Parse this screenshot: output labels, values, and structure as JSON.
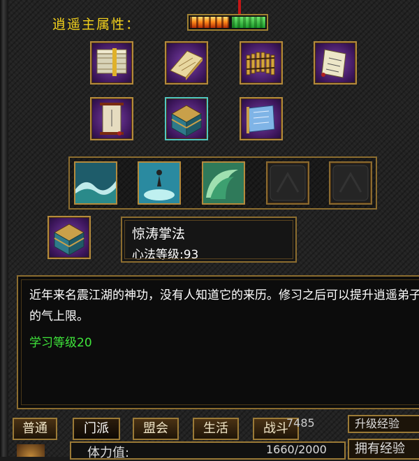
{
  "header": {
    "attr_label": "逍遥主属性：",
    "attr_icons": [
      "fire-element-icon",
      "wood-element-icon"
    ],
    "attr_colors": {
      "fire": "#ff8a1a",
      "wood": "#3fd84a"
    }
  },
  "books": [
    {
      "name": "book-bundle-icon"
    },
    {
      "name": "scroll-book-icon"
    },
    {
      "name": "bamboo-scroll-icon"
    },
    {
      "name": "paper-scroll-icon"
    },
    {
      "name": "hanging-scroll-icon"
    },
    {
      "name": "treasure-chest-book-icon",
      "selected": true
    },
    {
      "name": "blue-scroll-icon"
    }
  ],
  "skills": [
    {
      "name": "wave-skill-icon"
    },
    {
      "name": "water-figure-skill-icon"
    },
    {
      "name": "tidal-wave-skill-icon"
    },
    {
      "name": "empty-skill-slot-icon"
    },
    {
      "name": "empty-skill-slot-icon"
    }
  ],
  "selected": {
    "name": "惊涛掌法",
    "level_label": "心法等级",
    "level_value": "93",
    "level_text": "心法等级:93"
  },
  "description": {
    "text": "近年来名震江湖的神功，没有人知道它的来历。修习之后可以提升逍遥弟子的气上限。",
    "requirement": "学习等级20"
  },
  "tabs": [
    {
      "label": "普通"
    },
    {
      "label": "门派",
      "active": true
    },
    {
      "label": "盟会"
    },
    {
      "label": "生活"
    },
    {
      "label": "战斗"
    }
  ],
  "status": {
    "exp_partial": "7485",
    "upgrade_exp_label": "升级经验",
    "vitality_label": "体力值:",
    "vitality_value": "1660/2000",
    "own_exp_label": "拥有经验"
  }
}
